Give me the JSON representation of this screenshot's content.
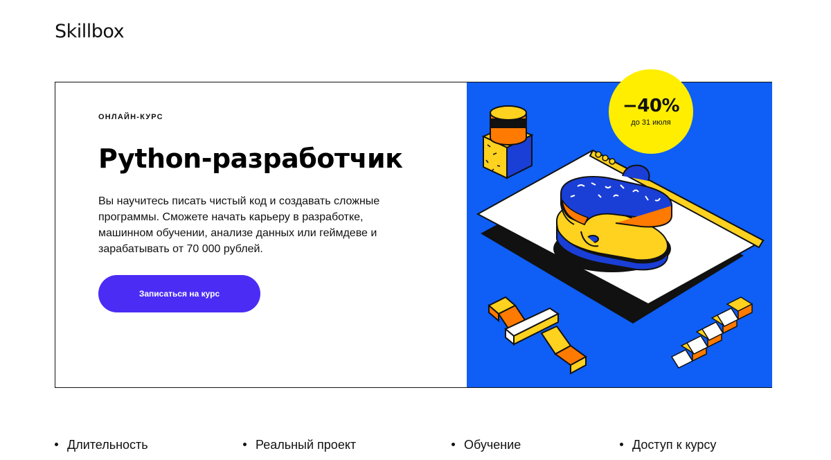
{
  "header": {
    "logo": "Skillbox"
  },
  "hero": {
    "eyebrow": "ОНЛАЙН-КУРС",
    "title": "Python-разработчик",
    "description": "Вы научитесь писать чистый код и создавать сложные программы. Сможете начать карьеру в разработке, машинном обучении, анализе данных или геймдеве и зарабатывать от 70 000 рублей.",
    "cta_label": "Записаться на курс",
    "colors": {
      "cta": "#4a2cf5",
      "illustration_bg": "#0f5ef5",
      "badge": "#ffee00",
      "accent_orange": "#ff7a00",
      "accent_yellow": "#ffd21f"
    }
  },
  "badge": {
    "discount": "−40%",
    "deadline": "до 31 июля"
  },
  "features": [
    {
      "label": "Длительность"
    },
    {
      "label": "Реальный проект"
    },
    {
      "label": "Обучение"
    },
    {
      "label": "Доступ к курсу"
    }
  ]
}
